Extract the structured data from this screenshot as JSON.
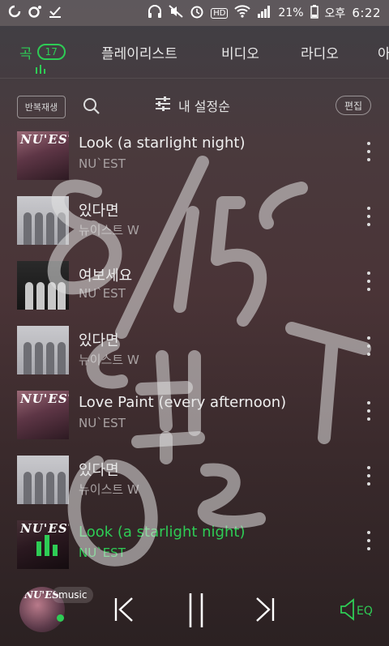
{
  "status_bar": {
    "battery_percent": "21%",
    "ampm": "오후",
    "time": "6:22",
    "hd_label": "HD"
  },
  "tabs": [
    {
      "label": "곡",
      "count": "17",
      "active": true
    },
    {
      "label": "플레이리스트"
    },
    {
      "label": "비디오"
    },
    {
      "label": "라디오"
    },
    {
      "label": "아"
    }
  ],
  "toolbar": {
    "repeat_label": "반복재생",
    "sort_label": "내 설정순",
    "edit_label": "편집"
  },
  "songs": [
    {
      "title": "Look (a starlight night)",
      "artist": "NU`EST",
      "thumb": "nuest"
    },
    {
      "title": "있다면",
      "artist": "뉴이스트 W",
      "thumb": "w"
    },
    {
      "title": "여보세요",
      "artist": "NU`EST",
      "thumb": "dark"
    },
    {
      "title": "있다면",
      "artist": "뉴이스트 W",
      "thumb": "w"
    },
    {
      "title": "Love Paint (every afternoon)",
      "artist": "NU`EST",
      "thumb": "nuest"
    },
    {
      "title": "있다면",
      "artist": "뉴이스트 W",
      "thumb": "w"
    },
    {
      "title": "Look (a starlight night)",
      "artist": "NU`EST",
      "thumb": "nuest",
      "playing": true
    }
  ],
  "player": {
    "source_tag": "music",
    "eq_label": "EQ"
  },
  "handwriting_overlay": "8/15 0|영ㅎ",
  "colors": {
    "accent": "#2ecc55",
    "background_top": "#3f3f45",
    "background_bottom": "#2b2122"
  }
}
